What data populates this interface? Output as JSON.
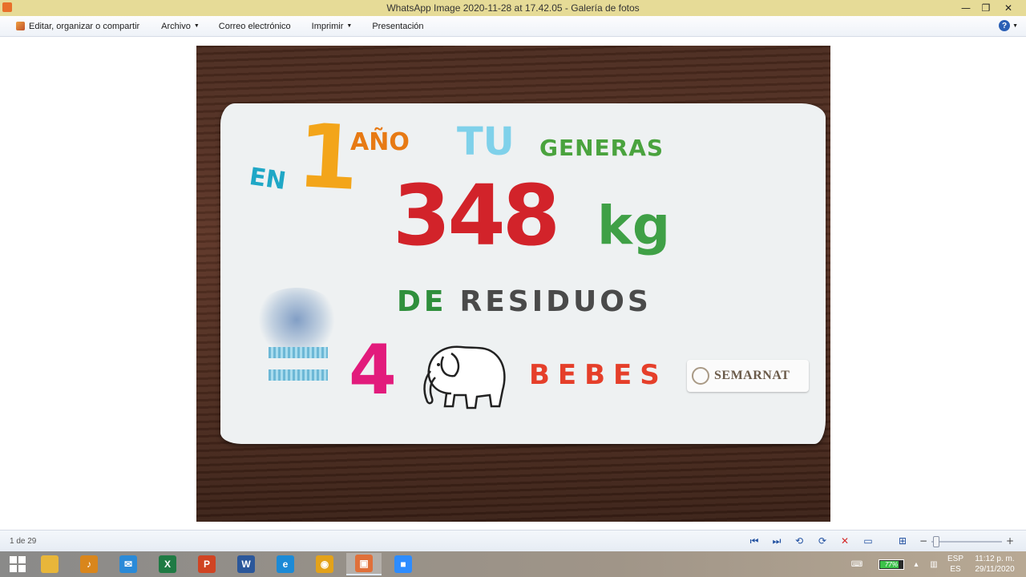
{
  "window": {
    "title": "WhatsApp Image 2020-11-28 at 17.42.05 - Galería de fotos",
    "controls": {
      "minimize": "—",
      "maximize": "❐",
      "close": "✕"
    }
  },
  "toolbar": {
    "edit_label": "Editar, organizar o compartir",
    "archivo_label": "Archivo",
    "correo_label": "Correo electrónico",
    "imprimir_label": "Imprimir",
    "presentacion_label": "Presentación",
    "help_label": "?",
    "caret": "▼"
  },
  "photo": {
    "en": "EN",
    "one": "1",
    "ano": "AÑO",
    "tu": "TU",
    "generas": "GENERAS",
    "amount": "348",
    "unit": "kg",
    "de": "DE",
    "residuos": "RESIDUOS",
    "four": "4",
    "bebes": "BEBES",
    "logo": "SEMARNAT"
  },
  "status": {
    "counter": "1 de 29",
    "zoom_level": 0.02
  },
  "controls": {
    "first": "⏮",
    "next": "⏭",
    "rotate_left": "⟲",
    "rotate_right": "⟳",
    "delete": "✕",
    "slideshow": "▭",
    "fit": "⊞",
    "zoom_out": "−",
    "zoom_in": "+"
  },
  "taskbar": {
    "apps": [
      {
        "name": "file-explorer",
        "color": "#e8b63a",
        "glyph": ""
      },
      {
        "name": "audio-app",
        "color": "#d9861c",
        "glyph": "♪"
      },
      {
        "name": "mail",
        "color": "#2a8ad8",
        "glyph": "✉"
      },
      {
        "name": "excel",
        "color": "#1f7a44",
        "glyph": "X"
      },
      {
        "name": "powerpoint",
        "color": "#d04423",
        "glyph": "P"
      },
      {
        "name": "word",
        "color": "#2b579a",
        "glyph": "W"
      },
      {
        "name": "edge",
        "color": "#1c8ad6",
        "glyph": "e"
      },
      {
        "name": "chrome",
        "color": "#e3a21a",
        "glyph": "◉"
      },
      {
        "name": "photo-gallery",
        "color": "#e0703a",
        "glyph": "▣"
      },
      {
        "name": "zoom",
        "color": "#2d8cff",
        "glyph": "■"
      }
    ],
    "battery_pct": "77%",
    "battery_level": 0.77,
    "lang_top": "ESP",
    "lang_bottom": "ES",
    "time": "11:12 p. m.",
    "date": "29/11/2020"
  }
}
